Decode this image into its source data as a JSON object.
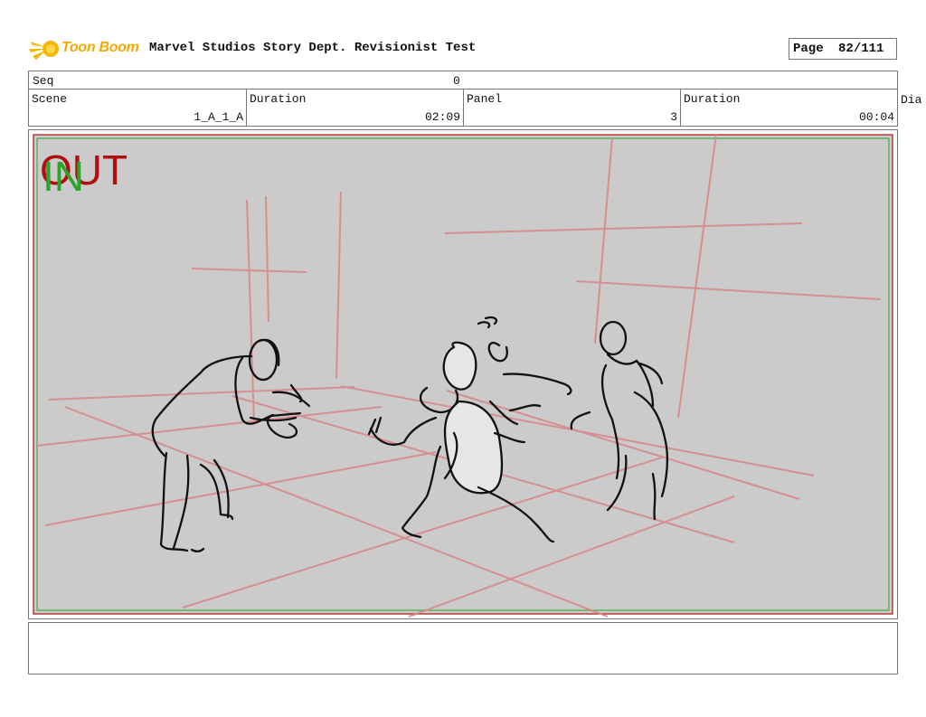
{
  "header": {
    "logo_text": "Toon Boom",
    "project_title": "Marvel Studios Story Dept. Revisionist Test",
    "page_label": "Page",
    "page_value": "82/111"
  },
  "info": {
    "seq_label": "Seq",
    "seq_value": "0",
    "scene_label": "Scene",
    "scene_value": "1_A_1_A",
    "scene_duration_label": "Duration",
    "scene_duration_value": "02:09",
    "panel_label": "Panel",
    "panel_value": "3",
    "panel_duration_label": "Duration",
    "panel_duration_value": "00:04",
    "dialog_label": "Dia"
  },
  "panel": {
    "in_marker": "IN",
    "out_marker": "OUT",
    "in_color": "#2aa52a",
    "out_color": "#b01010",
    "background": "#cbcbcb",
    "perspective_line_color": "#d98585"
  },
  "notes": {
    "text": ""
  }
}
